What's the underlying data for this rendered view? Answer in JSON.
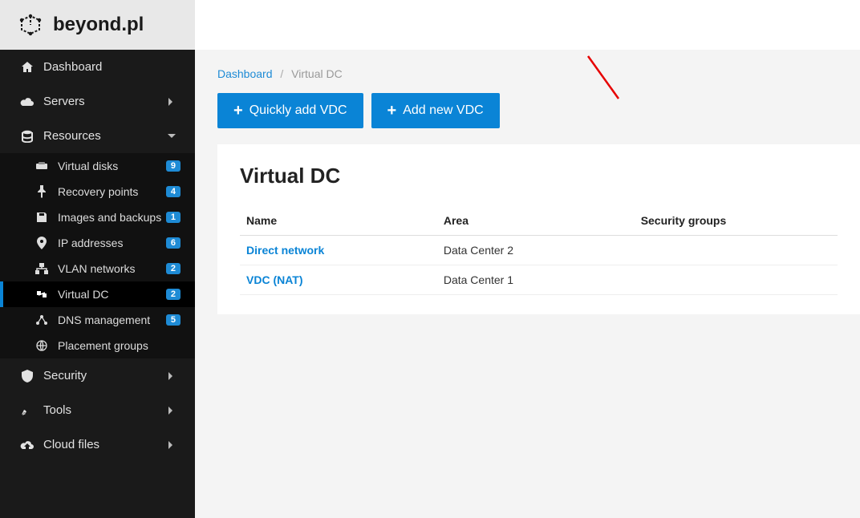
{
  "brand": "beyond.pl",
  "colors": {
    "accent": "#0a84d6"
  },
  "nav": {
    "dashboard": {
      "label": "Dashboard"
    },
    "servers": {
      "label": "Servers"
    },
    "resources": {
      "label": "Resources"
    },
    "security": {
      "label": "Security"
    },
    "tools": {
      "label": "Tools"
    },
    "cloudfiles": {
      "label": "Cloud files"
    }
  },
  "resources_sub": [
    {
      "label": "Virtual disks",
      "badge": "9"
    },
    {
      "label": "Recovery points",
      "badge": "4"
    },
    {
      "label": "Images and backups",
      "badge": "1"
    },
    {
      "label": "IP addresses",
      "badge": "6"
    },
    {
      "label": "VLAN networks",
      "badge": "2"
    },
    {
      "label": "Virtual DC",
      "badge": "2"
    },
    {
      "label": "DNS management",
      "badge": "5"
    },
    {
      "label": "Placement groups",
      "badge": ""
    }
  ],
  "breadcrumb": {
    "root": "Dashboard",
    "current": "Virtual DC"
  },
  "actions": {
    "quick_add": "Quickly add VDC",
    "add_new": "Add new VDC"
  },
  "panel": {
    "title": "Virtual DC",
    "columns": {
      "name": "Name",
      "area": "Area",
      "security": "Security groups"
    },
    "rows": [
      {
        "name": "Direct network",
        "area": "Data Center 2",
        "security": ""
      },
      {
        "name": "VDC (NAT)",
        "area": "Data Center 1",
        "security": ""
      }
    ]
  }
}
